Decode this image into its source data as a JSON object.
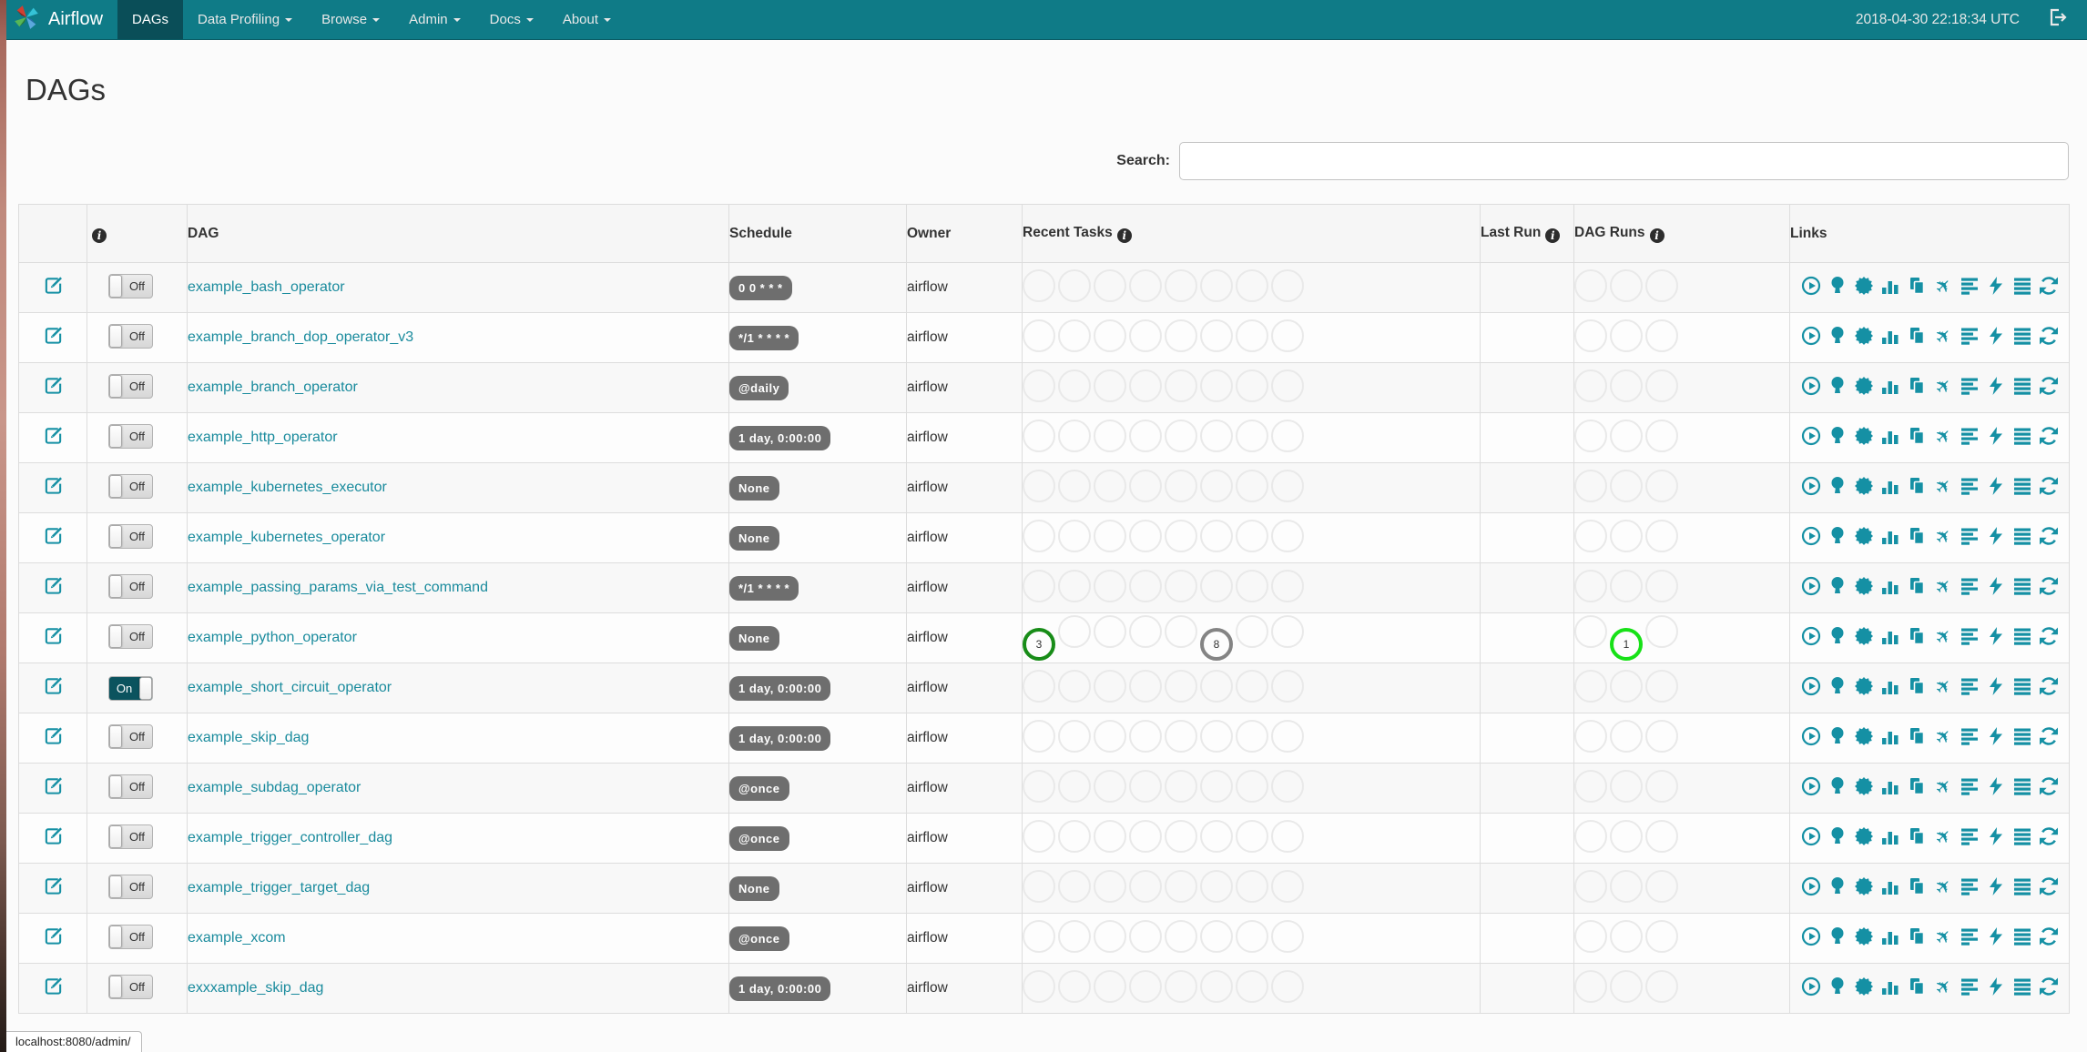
{
  "navbar": {
    "brand": "Airflow",
    "clock": "2018-04-30 22:18:34 UTC",
    "items": [
      {
        "id": "dags",
        "label": "DAGs",
        "active": true,
        "caret": false
      },
      {
        "id": "data-profiling",
        "label": "Data Profiling",
        "active": false,
        "caret": true
      },
      {
        "id": "browse",
        "label": "Browse",
        "active": false,
        "caret": true
      },
      {
        "id": "admin",
        "label": "Admin",
        "active": false,
        "caret": true
      },
      {
        "id": "docs",
        "label": "Docs",
        "active": false,
        "caret": true
      },
      {
        "id": "about",
        "label": "About",
        "active": false,
        "caret": true
      }
    ]
  },
  "page": {
    "title": "DAGs",
    "search_label": "Search:",
    "search_value": ""
  },
  "table": {
    "headers": {
      "dag": "DAG",
      "schedule": "Schedule",
      "owner": "Owner",
      "recent_tasks": "Recent Tasks",
      "last_run": "Last Run",
      "dag_runs": "DAG Runs",
      "links": "Links"
    },
    "toggle": {
      "on": "On",
      "off": "Off"
    },
    "state_colors": {
      "success": "#188c18",
      "queued": "#848484",
      "running": "#17e117",
      "empty": "#e9e9e9"
    },
    "links_icons": [
      "trigger-dag",
      "tree-view",
      "graph-view",
      "task-duration",
      "task-tries",
      "landing-times",
      "gantt",
      "code",
      "logs",
      "refresh"
    ],
    "recent_task_slots": 8,
    "dag_run_slots": 3,
    "rows": [
      {
        "name": "example_bash_operator",
        "schedule": "0 0 * * *",
        "owner": "airflow",
        "on": false,
        "recent_tasks": {},
        "dag_runs": {}
      },
      {
        "name": "example_branch_dop_operator_v3",
        "schedule": "*/1 * * * *",
        "owner": "airflow",
        "on": false,
        "recent_tasks": {},
        "dag_runs": {}
      },
      {
        "name": "example_branch_operator",
        "schedule": "@daily",
        "owner": "airflow",
        "on": false,
        "recent_tasks": {},
        "dag_runs": {}
      },
      {
        "name": "example_http_operator",
        "schedule": "1 day, 0:00:00",
        "owner": "airflow",
        "on": false,
        "recent_tasks": {},
        "dag_runs": {}
      },
      {
        "name": "example_kubernetes_executor",
        "schedule": "None",
        "owner": "airflow",
        "on": false,
        "recent_tasks": {},
        "dag_runs": {}
      },
      {
        "name": "example_kubernetes_operator",
        "schedule": "None",
        "owner": "airflow",
        "on": false,
        "recent_tasks": {},
        "dag_runs": {}
      },
      {
        "name": "example_passing_params_via_test_command",
        "schedule": "*/1 * * * *",
        "owner": "airflow",
        "on": false,
        "recent_tasks": {},
        "dag_runs": {}
      },
      {
        "name": "example_python_operator",
        "schedule": "None",
        "owner": "airflow",
        "on": false,
        "recent_tasks": {
          "0": {
            "count": 3,
            "state": "success"
          },
          "5": {
            "count": 8,
            "state": "queued"
          }
        },
        "dag_runs": {
          "1": {
            "count": 1,
            "state": "running"
          }
        }
      },
      {
        "name": "example_short_circuit_operator",
        "schedule": "1 day, 0:00:00",
        "owner": "airflow",
        "on": true,
        "recent_tasks": {},
        "dag_runs": {}
      },
      {
        "name": "example_skip_dag",
        "schedule": "1 day, 0:00:00",
        "owner": "airflow",
        "on": false,
        "recent_tasks": {},
        "dag_runs": {}
      },
      {
        "name": "example_subdag_operator",
        "schedule": "@once",
        "owner": "airflow",
        "on": false,
        "recent_tasks": {},
        "dag_runs": {}
      },
      {
        "name": "example_trigger_controller_dag",
        "schedule": "@once",
        "owner": "airflow",
        "on": false,
        "recent_tasks": {},
        "dag_runs": {}
      },
      {
        "name": "example_trigger_target_dag",
        "schedule": "None",
        "owner": "airflow",
        "on": false,
        "recent_tasks": {},
        "dag_runs": {}
      },
      {
        "name": "example_xcom",
        "schedule": "@once",
        "owner": "airflow",
        "on": false,
        "recent_tasks": {},
        "dag_runs": {}
      },
      {
        "name": "exxxample_skip_dag",
        "schedule": "1 day, 0:00:00",
        "owner": "airflow",
        "on": false,
        "recent_tasks": {},
        "dag_runs": {}
      }
    ]
  },
  "status_bar": {
    "url": "localhost:8080/admin/"
  }
}
